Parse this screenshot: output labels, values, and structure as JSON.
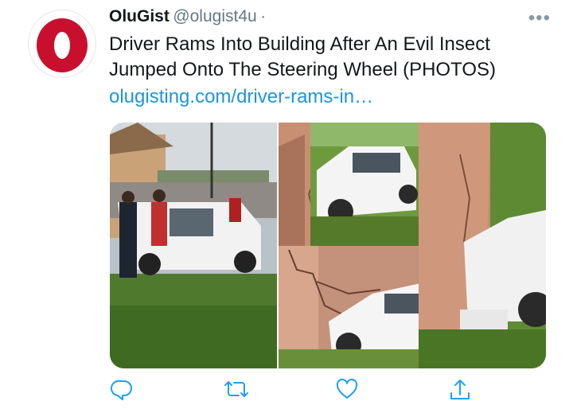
{
  "tweet": {
    "author_name": "OluGist",
    "author_handle": "@olugist4u",
    "separator": "·",
    "text": "Driver Rams Into Building After An Evil Insect Jumped Onto The Steering Wheel (PHOTOS)",
    "link": "olugisting.com/driver-rams-in…",
    "more_label": "•••"
  },
  "avatar": {
    "letter": "O",
    "brand_color": "#c8102e"
  },
  "actions": [
    {
      "name": "reply",
      "icon": "reply-icon"
    },
    {
      "name": "retweet",
      "icon": "retweet-icon"
    },
    {
      "name": "like",
      "icon": "heart-icon"
    },
    {
      "name": "share",
      "icon": "share-icon"
    }
  ],
  "colors": {
    "link": "#1b95e0",
    "secondary": "#657786",
    "icon": "#1da1f2"
  }
}
